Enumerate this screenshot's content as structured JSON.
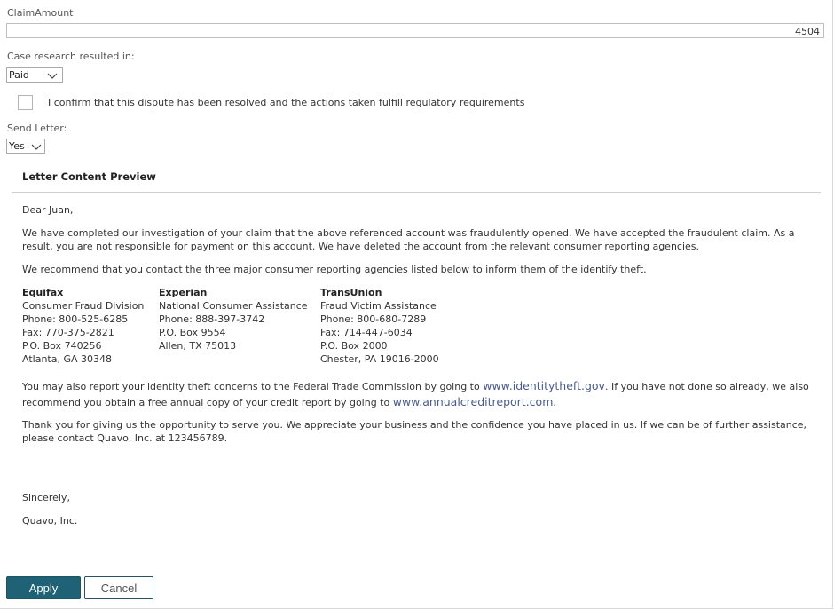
{
  "claim": {
    "label": "ClaimAmount",
    "value": "4504"
  },
  "research": {
    "label": "Case research resulted in:",
    "selected": "Paid"
  },
  "confirm": {
    "label": "I confirm that this dispute has been resolved and the actions taken fulfill regulatory requirements",
    "checked": false
  },
  "send_letter": {
    "label": "Send Letter:",
    "selected": "Yes"
  },
  "preview": {
    "title": "Letter Content Preview",
    "greeting": "Dear Juan,",
    "p1": "We have completed our investigation of your claim that the above referenced account was fraudulently opened.  We have accepted the fraudulent claim.  As a result, you are not responsible for payment on this account.  We have deleted the account from the relevant consumer reporting agencies.",
    "p2": "We recommend that you contact the three major consumer reporting agencies listed below to inform them of the identify theft.",
    "agencies": [
      {
        "name": "Equifax",
        "lines": [
          "Consumer Fraud Division",
          "Phone: 800-525-6285",
          "Fax: 770-375-2821",
          "P.O. Box 740256",
          "Atlanta, GA 30348"
        ]
      },
      {
        "name": "Experian",
        "lines": [
          "National Consumer Assistance",
          "Phone: 888-397-3742",
          "P.O. Box 9554",
          "Allen, TX 75013"
        ]
      },
      {
        "name": "TransUnion",
        "lines": [
          "Fraud Victim Assistance",
          "Phone: 800-680-7289",
          "Fax: 714-447-6034",
          "P.O. Box 2000",
          "Chester, PA 19016-2000"
        ]
      }
    ],
    "p3_a": "You may also report your identity theft concerns to the Federal Trade Commission by going to ",
    "p3_link1": "www.identitytheft.gov",
    "p3_b": ". If you have not done so already, we also recommend you obtain a free annual copy of your credit report by going to ",
    "p3_link2": "www.annualcreditreport.com",
    "p3_c": ".",
    "p4": "Thank you for giving us the opportunity to serve you. We appreciate your business and the confidence you have placed in us.  If we can be of further assistance, please contact Quavo, Inc. at 123456789.",
    "closing": "Sincerely,",
    "signature": "Quavo, Inc."
  },
  "actions": {
    "apply": "Apply",
    "cancel": "Cancel"
  },
  "colors": {
    "apply_bg": "#1f6275",
    "link": "#4a5a8a"
  }
}
